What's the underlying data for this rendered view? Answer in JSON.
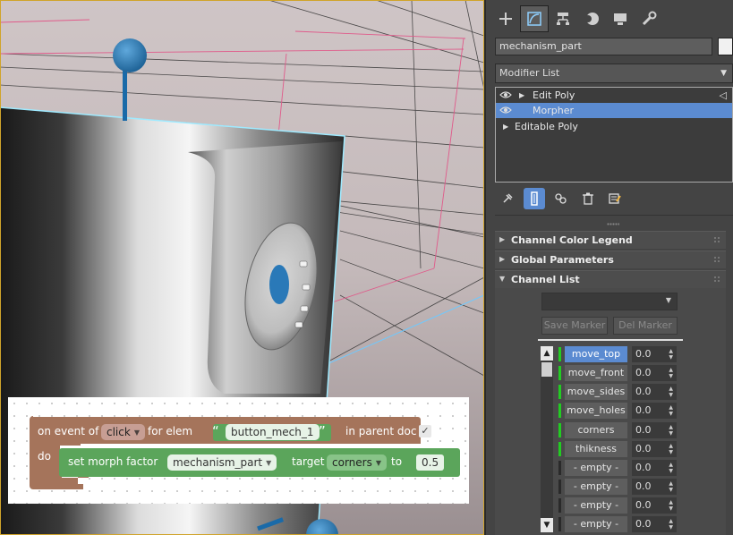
{
  "panel": {
    "object_name": "mechanism_part",
    "modifier_list_label": "Modifier List",
    "stack": [
      {
        "label": "Edit Poly",
        "has_eye": true,
        "selected": false
      },
      {
        "label": "Morpher",
        "has_eye": true,
        "selected": true
      },
      {
        "label": "Editable Poly",
        "has_eye": false,
        "selected": false
      }
    ],
    "rollouts": {
      "channel_color_legend": "Channel Color Legend",
      "global_parameters": "Global Parameters",
      "channel_list": "Channel List"
    },
    "save_marker": "Save Marker",
    "del_marker": "Del Marker",
    "channels": [
      {
        "name": "move_top",
        "value": "0.0",
        "active": true,
        "selected": true
      },
      {
        "name": "move_front",
        "value": "0.0",
        "active": true,
        "selected": false
      },
      {
        "name": "move_sides",
        "value": "0.0",
        "active": true,
        "selected": false
      },
      {
        "name": "move_holes",
        "value": "0.0",
        "active": true,
        "selected": false
      },
      {
        "name": "corners",
        "value": "0.0",
        "active": true,
        "selected": false
      },
      {
        "name": "thikness",
        "value": "0.0",
        "active": true,
        "selected": false
      },
      {
        "name": "- empty -",
        "value": "0.0",
        "active": false,
        "selected": false
      },
      {
        "name": "- empty -",
        "value": "0.0",
        "active": false,
        "selected": false
      },
      {
        "name": "- empty -",
        "value": "0.0",
        "active": false,
        "selected": false
      },
      {
        "name": "- empty -",
        "value": "0.0",
        "active": false,
        "selected": false
      },
      {
        "name": "- empty -",
        "value": "0.0",
        "active": false,
        "selected": false
      }
    ],
    "colors": {
      "accent": "#5b8bd1",
      "channel_active": "#22cc22",
      "channel_empty": "#2a2a2a"
    }
  },
  "blocks": {
    "event": {
      "on_event_of": "on event of",
      "event_value": "click",
      "for_elem": "for elem",
      "elem_value": "button_mech_1",
      "in_parent_doc": "in parent doc",
      "do_label": "do"
    },
    "action": {
      "set_morph_factor": "set morph factor",
      "object_value": "mechanism_part",
      "target_label": "target",
      "target_value": "corners",
      "to_label": "to",
      "factor_value": "0.5"
    },
    "colors": {
      "event_block": "#a5745b",
      "action_block": "#5ba55b"
    }
  }
}
